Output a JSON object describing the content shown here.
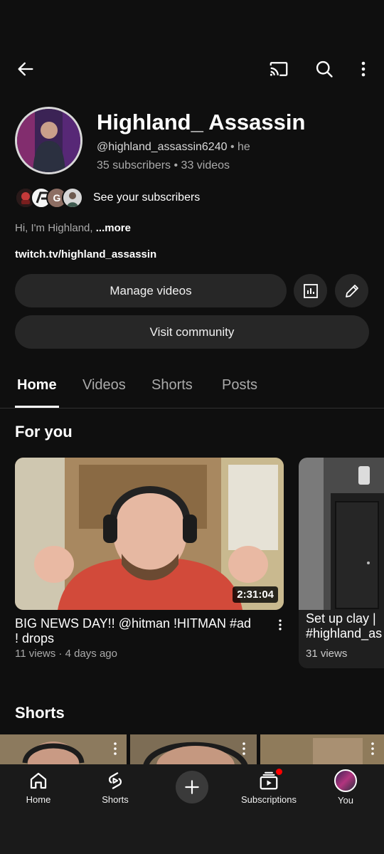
{
  "header": {
    "back_icon": "arrow-left-icon",
    "cast_icon": "cast-icon",
    "search_icon": "search-icon",
    "more_icon": "more-vertical-icon"
  },
  "channel": {
    "name": "Highland_ Assassin",
    "handle": "@highland_assassin6240",
    "handle_suffix": "• he",
    "stats": "35 subscribers • 33 videos",
    "subscribers_link": "See your subscribers",
    "subscriber_avatar_letter": "G",
    "bio_text": "Hi, I'm Highland, ",
    "bio_more": "...more",
    "link": "twitch.tv/highland_assassin"
  },
  "actions": {
    "manage_videos": "Manage videos",
    "analytics_icon": "analytics-icon",
    "edit_icon": "pencil-icon",
    "visit_community": "Visit community"
  },
  "tabs": [
    "Home",
    "Videos",
    "Shorts",
    "Posts"
  ],
  "active_tab": "Home",
  "for_you": {
    "title": "For you",
    "videos": [
      {
        "title": "BIG NEWS DAY!! @hitman !HITMAN #ad ! drops",
        "meta": "11 views · 4 days ago",
        "duration": "2:31:04"
      },
      {
        "title": "Set  up clay | #highland_as",
        "meta": "31 views"
      }
    ]
  },
  "shorts": {
    "title": "Shorts"
  },
  "bottom_nav": [
    {
      "label": "Home",
      "icon": "home-icon"
    },
    {
      "label": "Shorts",
      "icon": "shorts-icon"
    },
    {
      "label": "",
      "icon": "plus-icon"
    },
    {
      "label": "Subscriptions",
      "icon": "subscriptions-icon"
    },
    {
      "label": "You",
      "icon": "avatar"
    }
  ],
  "colors": {
    "background": "#0f0f0f",
    "button_bg": "#272727",
    "notification_dot": "#ff0000"
  }
}
